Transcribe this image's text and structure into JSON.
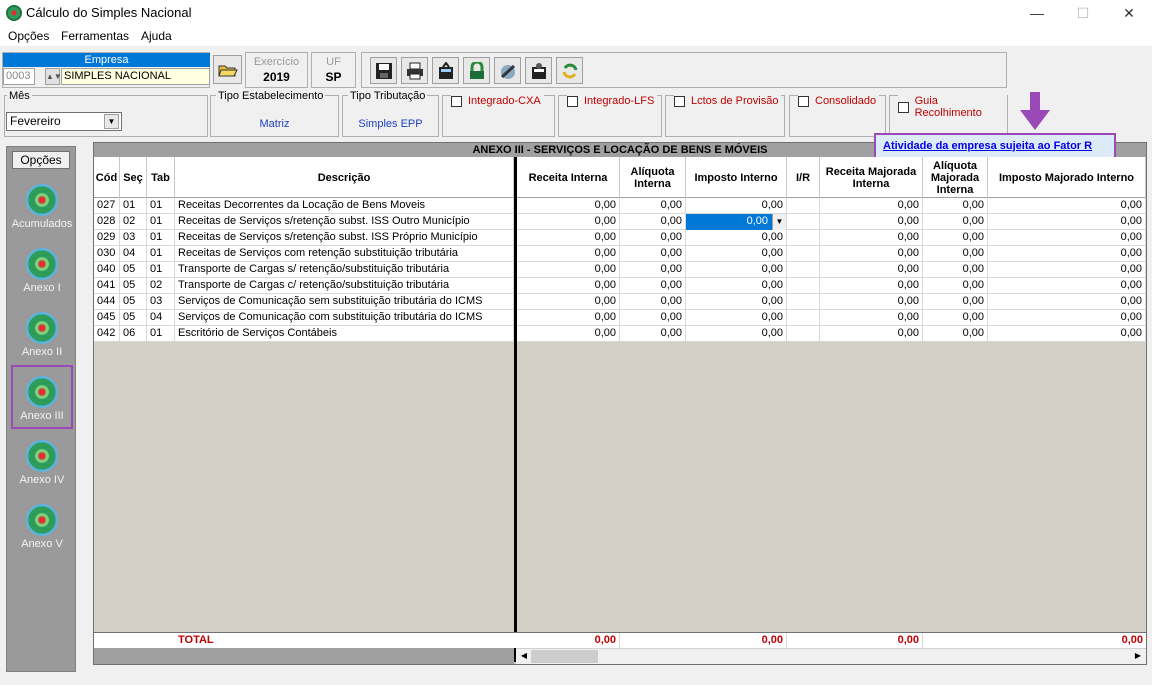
{
  "window": {
    "title": "Cálculo do Simples Nacional",
    "minimize": "—",
    "maximize": "☐",
    "close": "✕"
  },
  "menu": [
    {
      "label": "Opções"
    },
    {
      "label": "Ferramentas"
    },
    {
      "label": "Ajuda"
    }
  ],
  "empresa": {
    "header": "Empresa",
    "code": "0003",
    "name": "SIMPLES NACIONAL"
  },
  "exercicio": {
    "label": "Exercício",
    "value": "2019"
  },
  "uf": {
    "label": "UF",
    "value": "SP"
  },
  "filters": {
    "mes_label": "Mês",
    "mes_value": "Fevereiro",
    "tipo_estab_label": "Tipo Estabelecimento",
    "tipo_estab_value": "Matriz",
    "tipo_trib_label": "Tipo Tributação",
    "tipo_trib_value": "Simples EPP",
    "checks": [
      "Integrado-CXA",
      "Integrado-LFS",
      "Lctos de Provisão",
      "Consolidado",
      "Guia Recolhimento"
    ]
  },
  "fator_r_link": "Atividade da empresa sujeita ao Fator R",
  "sidebar": {
    "header": "Opções",
    "items": [
      "Acumulados",
      "Anexo I",
      "Anexo II",
      "Anexo III",
      "Anexo IV",
      "Anexo V"
    ],
    "selected": "Anexo III"
  },
  "grid": {
    "title": "ANEXO III - SERVIÇOS E LOCAÇÃO DE BENS E MÓVEIS",
    "columns": [
      "Cód",
      "Seç",
      "Tab",
      "Descrição",
      "Receita Interna",
      "Alíquota Interna",
      "Imposto Interno",
      "I/R",
      "Receita Majorada Interna",
      "Alíquota Majorada Interna",
      "Imposto Majorado Interno"
    ],
    "rows": [
      {
        "cod": "027",
        "sec": "01",
        "tab": "01",
        "desc": "Receitas Decorrentes da Locação de Bens Moveis",
        "rec": "0,00",
        "aliq": "0,00",
        "imp": "0,00",
        "ir": "",
        "recm": "0,00",
        "aliqm": "0,00",
        "impm": "0,00"
      },
      {
        "cod": "028",
        "sec": "02",
        "tab": "01",
        "desc": "Receitas de Serviços s/retenção subst. ISS Outro Município",
        "rec": "0,00",
        "aliq": "0,00",
        "imp": "0,00",
        "ir": "",
        "recm": "0,00",
        "aliqm": "0,00",
        "impm": "0,00"
      },
      {
        "cod": "029",
        "sec": "03",
        "tab": "01",
        "desc": "Receitas de Serviços s/retenção subst. ISS Próprio Município",
        "rec": "0,00",
        "aliq": "0,00",
        "imp": "0,00",
        "ir": "",
        "recm": "0,00",
        "aliqm": "0,00",
        "impm": "0,00"
      },
      {
        "cod": "030",
        "sec": "04",
        "tab": "01",
        "desc": "Receitas de Serviços com retenção substituição tributária",
        "rec": "0,00",
        "aliq": "0,00",
        "imp": "0,00",
        "ir": "",
        "recm": "0,00",
        "aliqm": "0,00",
        "impm": "0,00"
      },
      {
        "cod": "040",
        "sec": "05",
        "tab": "01",
        "desc": "Transporte de Cargas s/ retenção/substituição tributária",
        "rec": "0,00",
        "aliq": "0,00",
        "imp": "0,00",
        "ir": "",
        "recm": "0,00",
        "aliqm": "0,00",
        "impm": "0,00"
      },
      {
        "cod": "041",
        "sec": "05",
        "tab": "02",
        "desc": "Transporte de Cargas c/ retenção/substituição tributária",
        "rec": "0,00",
        "aliq": "0,00",
        "imp": "0,00",
        "ir": "",
        "recm": "0,00",
        "aliqm": "0,00",
        "impm": "0,00"
      },
      {
        "cod": "044",
        "sec": "05",
        "tab": "03",
        "desc": "Serviços de Comunicação sem substituição tributária do ICMS",
        "rec": "0,00",
        "aliq": "0,00",
        "imp": "0,00",
        "ir": "",
        "recm": "0,00",
        "aliqm": "0,00",
        "impm": "0,00"
      },
      {
        "cod": "045",
        "sec": "05",
        "tab": "04",
        "desc": "Serviços de Comunicação com substituição tributária do ICMS",
        "rec": "0,00",
        "aliq": "0,00",
        "imp": "0,00",
        "ir": "",
        "recm": "0,00",
        "aliqm": "0,00",
        "impm": "0,00"
      },
      {
        "cod": "042",
        "sec": "06",
        "tab": "01",
        "desc": "Escritório de Serviços Contábeis",
        "rec": "0,00",
        "aliq": "0,00",
        "imp": "0,00",
        "ir": "",
        "recm": "0,00",
        "aliqm": "0,00",
        "impm": "0,00"
      }
    ],
    "total": {
      "label": "TOTAL",
      "rec": "0,00",
      "imp": "0,00",
      "recm": "0,00",
      "impm": "0,00"
    }
  },
  "colors": {
    "accent": "#0078d7",
    "highlight_box": "#9b49b7",
    "checkbox_label": "#c00000",
    "link": "#0000ee"
  },
  "icons": [
    "open-folder-icon",
    "save-icon",
    "print-icon",
    "calculator-icon",
    "lock-icon",
    "tools-icon",
    "report-icon",
    "refresh-icon",
    "down-arrow-icon",
    "app-logo-icon"
  ]
}
